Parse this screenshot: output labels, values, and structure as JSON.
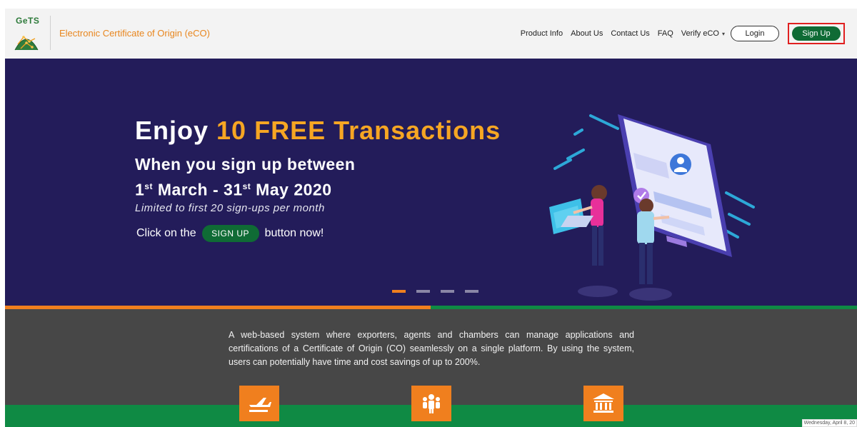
{
  "header": {
    "logo_text": "GeTS",
    "app_title": "Electronic Certificate of Origin (eCO)",
    "nav": {
      "product_info": "Product Info",
      "about_us": "About Us",
      "contact_us": "Contact Us",
      "faq": "FAQ",
      "verify_eco": "Verify eCO"
    },
    "login_label": "Login",
    "signup_label": "Sign Up"
  },
  "hero": {
    "title_prefix": "Enjoy ",
    "title_accent": "10 FREE Transactions",
    "subtitle_line1": "When you sign up between",
    "date_start_day": "1",
    "date_start_suffix": "st",
    "date_start_rest": " March - 31",
    "date_end_suffix": "st",
    "date_end_rest": " May 2020",
    "limit_text": "Limited to first 20 sign-ups per month",
    "cta_prefix": "Click on the",
    "cta_button": "SIGN UP",
    "cta_suffix": "button now!",
    "slides": 4,
    "active_slide": 1
  },
  "info": {
    "description": "A web-based system where exporters, agents and chambers can manage applications and certifications of a Certificate of Origin (CO) seamlessly on a single platform. By using the system, users can potentially have time and cost savings of up to 200%."
  },
  "features": {
    "icons": [
      "airplane-icon",
      "people-icon",
      "bank-icon"
    ]
  },
  "timestamp": "Wednesday, April 8, 20",
  "colors": {
    "brand_green": "#0f6b35",
    "accent_orange": "#f07f1e",
    "hero_bg": "#231c5a",
    "highlight_yellow": "#f6a623",
    "info_bg": "#474747",
    "signup_highlight_border": "#e02020"
  }
}
